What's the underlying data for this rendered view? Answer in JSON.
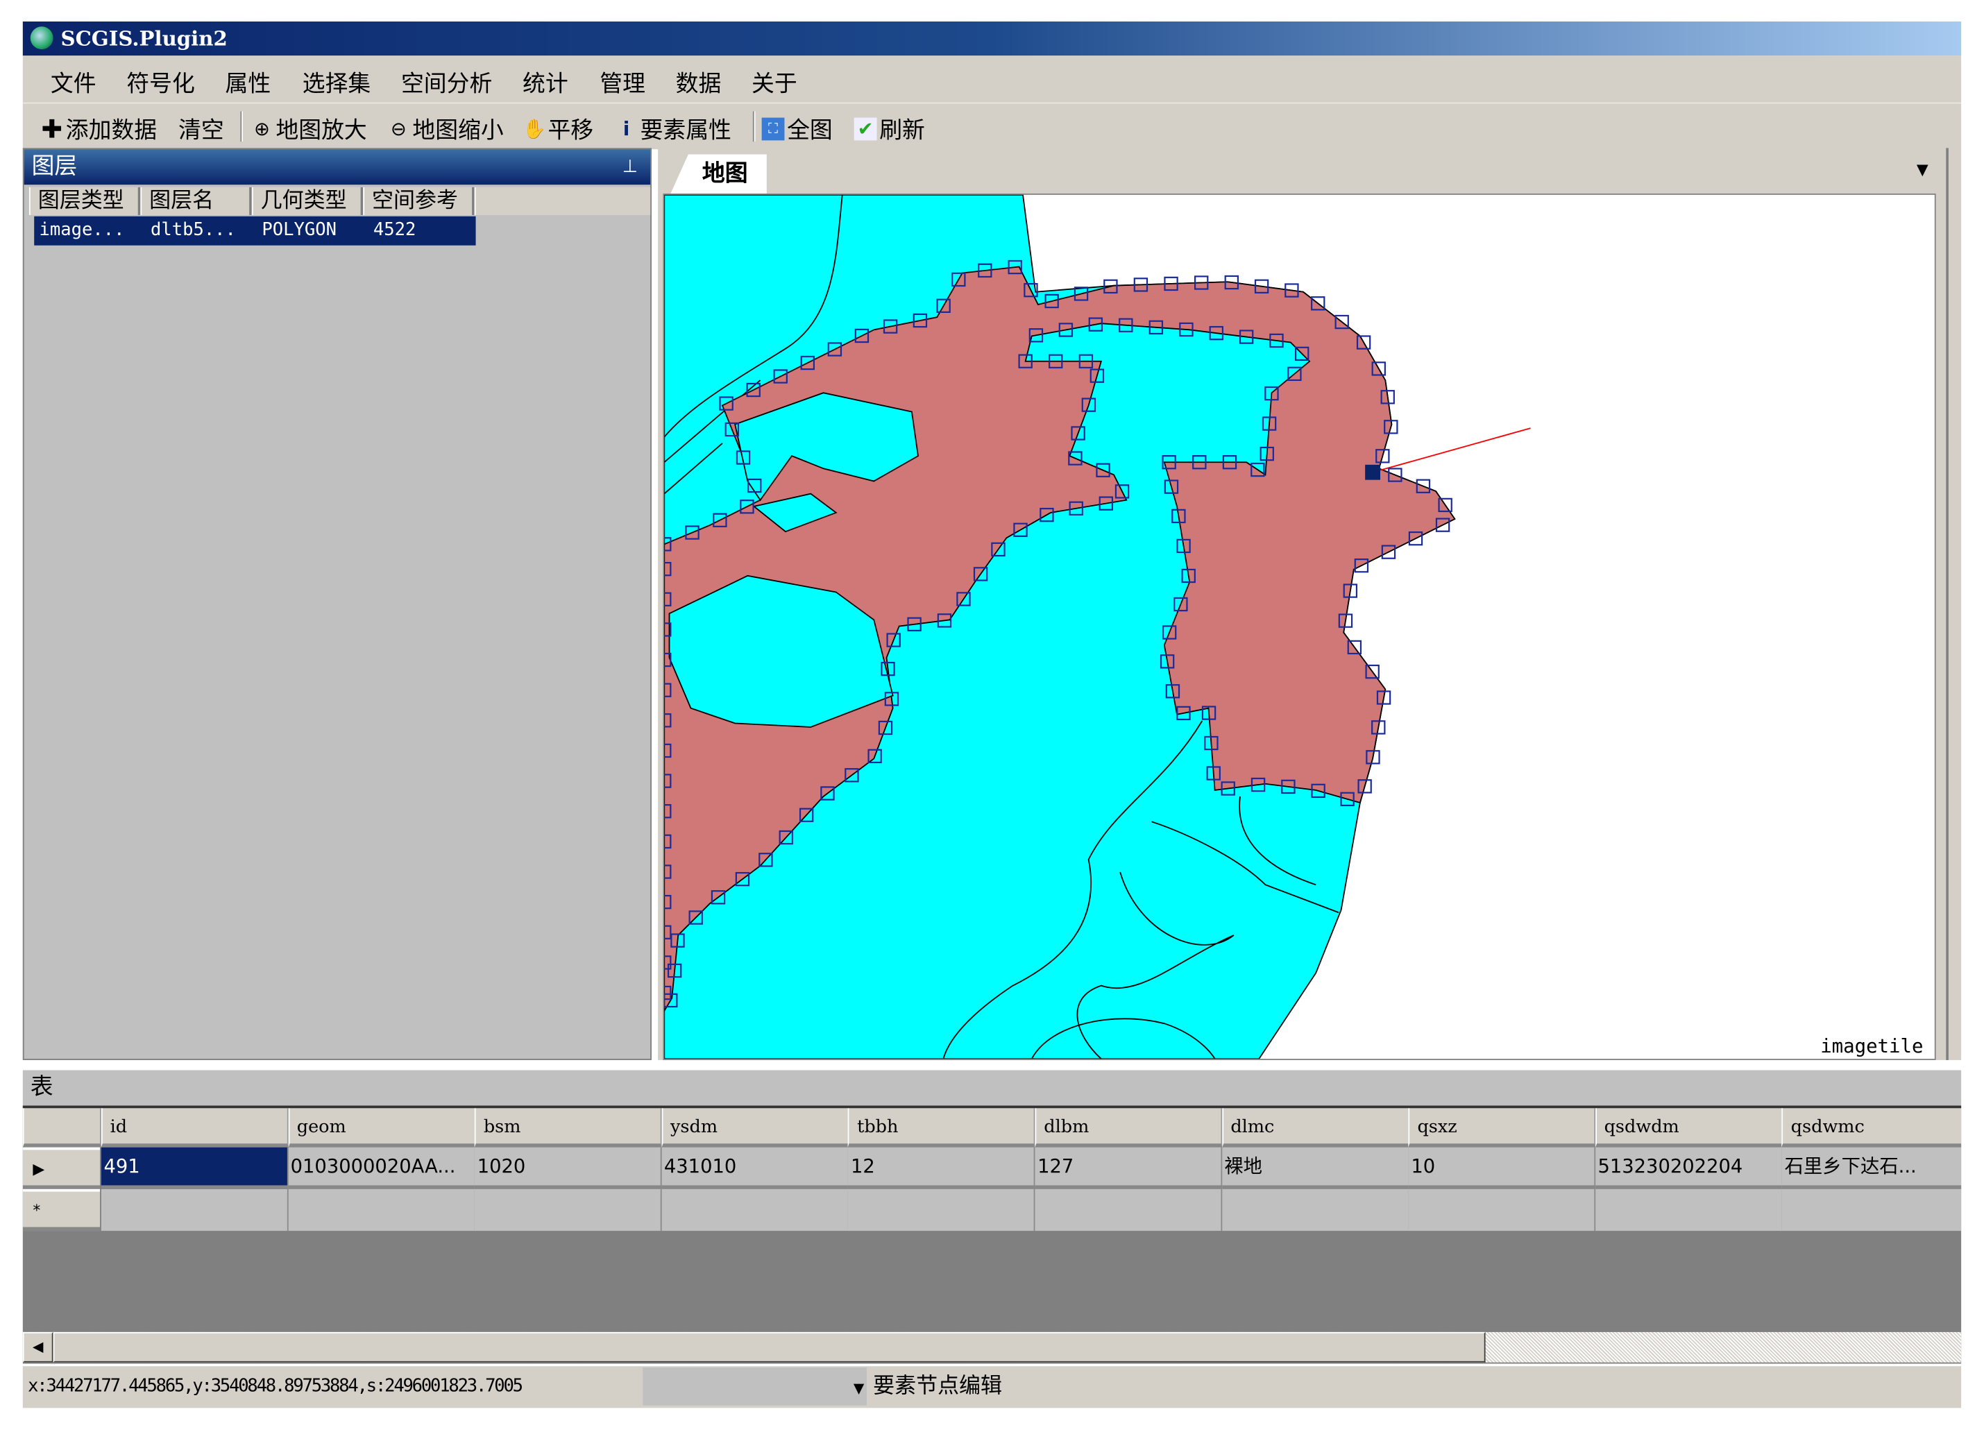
{
  "window": {
    "title": "SCGIS.Plugin2"
  },
  "menu": [
    "文件",
    "符号化",
    "属性",
    "选择集",
    "空间分析",
    "统计",
    "管理",
    "数据",
    "关于"
  ],
  "toolbar": {
    "add_data": "添加数据",
    "clear": "清空",
    "zoom_in": "地图放大",
    "zoom_out": "地图缩小",
    "pan": "平移",
    "identify": "要素属性",
    "full_extent": "全图",
    "refresh": "刷新"
  },
  "layers_panel": {
    "title": "图层",
    "columns": [
      "图层类型",
      "图层名",
      "几何类型",
      "空间参考"
    ],
    "rows": [
      [
        "image...",
        "dltb5...",
        "POLYGON",
        "4522"
      ]
    ]
  },
  "map_panel": {
    "tab": "地图",
    "layer_label": "imagetile"
  },
  "colors": {
    "land": "#00ffff",
    "selected_polygon": "#d07878",
    "selection_highlight": "#0a246a",
    "edit_line": "#ff0000"
  },
  "table_panel": {
    "title": "表",
    "columns": [
      "id",
      "geom",
      "bsm",
      "ysdm",
      "tbbh",
      "dlbm",
      "dlmc",
      "qsxz",
      "qsdwdm",
      "qsdwmc"
    ],
    "rows": [
      [
        "491",
        "0103000020AA...",
        "1020",
        "431010",
        "12",
        "127",
        "裸地",
        "10",
        "513230202204",
        "石里乡下达石..."
      ]
    ],
    "row_markers": [
      "▶",
      "*"
    ]
  },
  "status": {
    "coords": "x:34427177.445865,y:3540848.89753884,s:2496001823.7005",
    "mode": "要素节点编辑"
  }
}
